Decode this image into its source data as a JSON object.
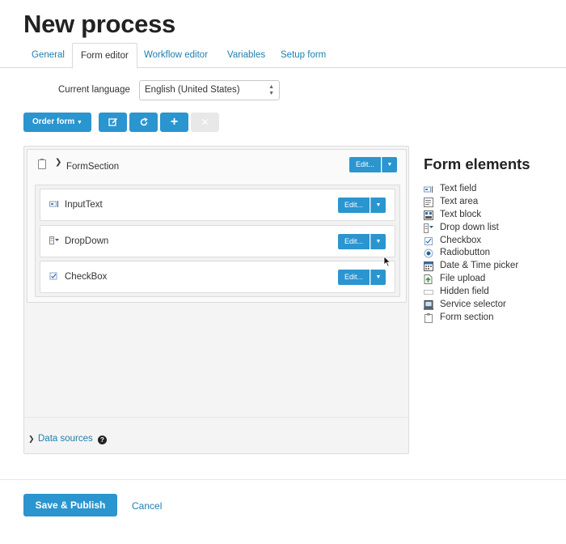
{
  "page": {
    "title": "New process"
  },
  "tabs": [
    {
      "label": "General",
      "active": false
    },
    {
      "label": "Form editor",
      "active": true
    },
    {
      "label": "Workflow editor",
      "active": false
    },
    {
      "label": "Variables",
      "active": false
    },
    {
      "label": "Setup form",
      "active": false
    }
  ],
  "language": {
    "label": "Current language",
    "value": "English (United States)"
  },
  "toolbar": {
    "order_form_label": "Order form",
    "icons": [
      "edit-icon",
      "refresh-icon",
      "plus-icon",
      "close-icon"
    ]
  },
  "form": {
    "section": {
      "name": "FormSection",
      "edit_label": "Edit..."
    },
    "fields": [
      {
        "name": "InputText",
        "icon": "text-field-icon",
        "edit_label": "Edit..."
      },
      {
        "name": "DropDown",
        "icon": "dropdown-icon",
        "edit_label": "Edit..."
      },
      {
        "name": "CheckBox",
        "icon": "checkbox-icon",
        "edit_label": "Edit..."
      }
    ],
    "data_sources_label": "Data sources",
    "help_glyph": "?"
  },
  "form_elements": {
    "title": "Form elements",
    "items": [
      {
        "label": "Text field",
        "icon": "text-field-icon"
      },
      {
        "label": "Text area",
        "icon": "text-area-icon"
      },
      {
        "label": "Text block",
        "icon": "text-block-icon"
      },
      {
        "label": "Drop down list",
        "icon": "dropdown-icon"
      },
      {
        "label": "Checkbox",
        "icon": "checkbox-icon"
      },
      {
        "label": "Radiobutton",
        "icon": "radio-icon"
      },
      {
        "label": "Date & Time picker",
        "icon": "calendar-icon"
      },
      {
        "label": "File upload",
        "icon": "file-upload-icon"
      },
      {
        "label": "Hidden field",
        "icon": "hidden-field-icon"
      },
      {
        "label": "Service selector",
        "icon": "service-selector-icon"
      },
      {
        "label": "Form section",
        "icon": "form-section-icon"
      }
    ]
  },
  "footer": {
    "save_label": "Save & Publish",
    "cancel_label": "Cancel"
  },
  "colors": {
    "accent": "#2b95cf",
    "link": "#1e7fae"
  }
}
